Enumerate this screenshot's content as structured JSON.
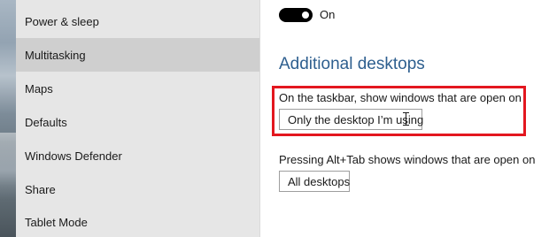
{
  "sidebar": {
    "items": [
      {
        "label": "Power & sleep",
        "selected": false
      },
      {
        "label": "Multitasking",
        "selected": true
      },
      {
        "label": "Maps",
        "selected": false
      },
      {
        "label": "Defaults",
        "selected": false
      },
      {
        "label": "Windows Defender",
        "selected": false
      },
      {
        "label": "Share",
        "selected": false
      },
      {
        "label": "Tablet Mode",
        "selected": false
      }
    ]
  },
  "main": {
    "toggle": {
      "state_label": "On",
      "on": true
    },
    "section_title": "Additional desktops",
    "taskbar_setting": {
      "label": "On the taskbar, show windows that are open on",
      "value": "Only the desktop I’m using"
    },
    "alttab_setting": {
      "label": "Pressing Alt+Tab shows windows that are open on",
      "value": "All desktops"
    }
  },
  "colors": {
    "accent": "#2e5f8f",
    "highlight_box": "#e3171f",
    "sidebar_bg": "#e6e6e6",
    "sidebar_selected_bg": "#cfcfcf"
  }
}
